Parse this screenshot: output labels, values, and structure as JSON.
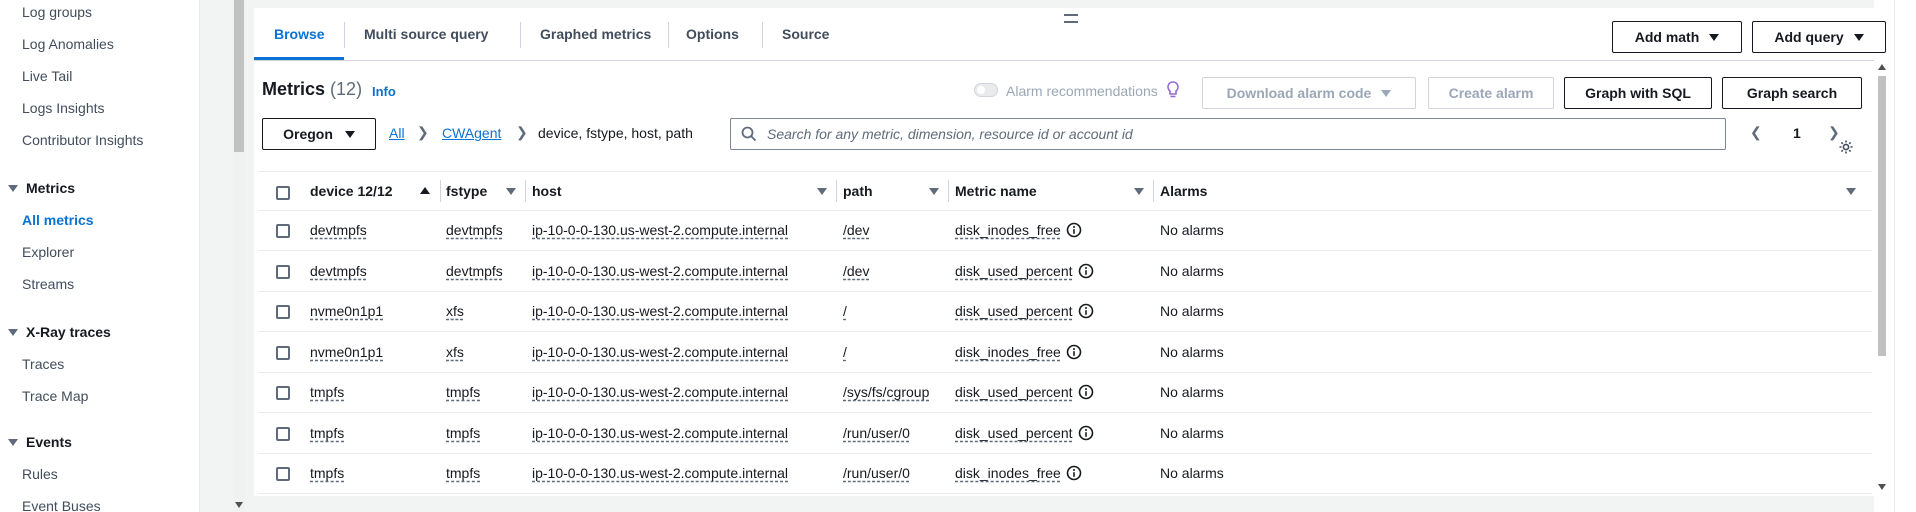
{
  "sidebar": {
    "items_top": [
      "Log groups",
      "Log Anomalies",
      "Live Tail",
      "Logs Insights",
      "Contributor Insights"
    ],
    "metrics_section": "Metrics",
    "metrics_items": [
      "All metrics",
      "Explorer",
      "Streams"
    ],
    "xray_section": "X-Ray traces",
    "xray_items": [
      "Traces",
      "Trace Map"
    ],
    "events_section": "Events",
    "events_items": [
      "Rules",
      "Event Buses"
    ]
  },
  "tabs": [
    "Browse",
    "Multi source query",
    "Graphed metrics",
    "Options",
    "Source"
  ],
  "toolbar": {
    "add_math": "Add math",
    "add_query": "Add query"
  },
  "header": {
    "title": "Metrics",
    "count": "(12)",
    "info": "Info",
    "alarm_recommendations": "Alarm recommendations",
    "download_alarm_code": "Download alarm code",
    "create_alarm": "Create alarm",
    "graph_with_sql": "Graph with SQL",
    "graph_search": "Graph search"
  },
  "filter": {
    "region": "Oregon",
    "crumb_all": "All",
    "crumb_namespace": "CWAgent",
    "crumb_dimensions": "device, fstype, host, path",
    "search_placeholder": "Search for any metric, dimension, resource id or account id",
    "page": "1"
  },
  "table": {
    "columns": [
      "device 12/12",
      "fstype",
      "host",
      "path",
      "Metric name",
      "Alarms"
    ],
    "rows": [
      [
        "devtmpfs",
        "devtmpfs",
        "ip-10-0-0-130.us-west-2.compute.internal",
        "/dev",
        "disk_inodes_free",
        "No alarms"
      ],
      [
        "devtmpfs",
        "devtmpfs",
        "ip-10-0-0-130.us-west-2.compute.internal",
        "/dev",
        "disk_used_percent",
        "No alarms"
      ],
      [
        "nvme0n1p1",
        "xfs",
        "ip-10-0-0-130.us-west-2.compute.internal",
        "/",
        "disk_used_percent",
        "No alarms"
      ],
      [
        "nvme0n1p1",
        "xfs",
        "ip-10-0-0-130.us-west-2.compute.internal",
        "/",
        "disk_inodes_free",
        "No alarms"
      ],
      [
        "tmpfs",
        "tmpfs",
        "ip-10-0-0-130.us-west-2.compute.internal",
        "/sys/fs/cgroup",
        "disk_used_percent",
        "No alarms"
      ],
      [
        "tmpfs",
        "tmpfs",
        "ip-10-0-0-130.us-west-2.compute.internal",
        "/run/user/0",
        "disk_used_percent",
        "No alarms"
      ],
      [
        "tmpfs",
        "tmpfs",
        "ip-10-0-0-130.us-west-2.compute.internal",
        "/run/user/0",
        "disk_inodes_free",
        "No alarms"
      ]
    ]
  },
  "colors": {
    "accent": "#0972d3",
    "text": "#16191f",
    "muted": "#5f6b7a",
    "disabled": "#9ba7b6",
    "bulb": "#9469d6"
  }
}
